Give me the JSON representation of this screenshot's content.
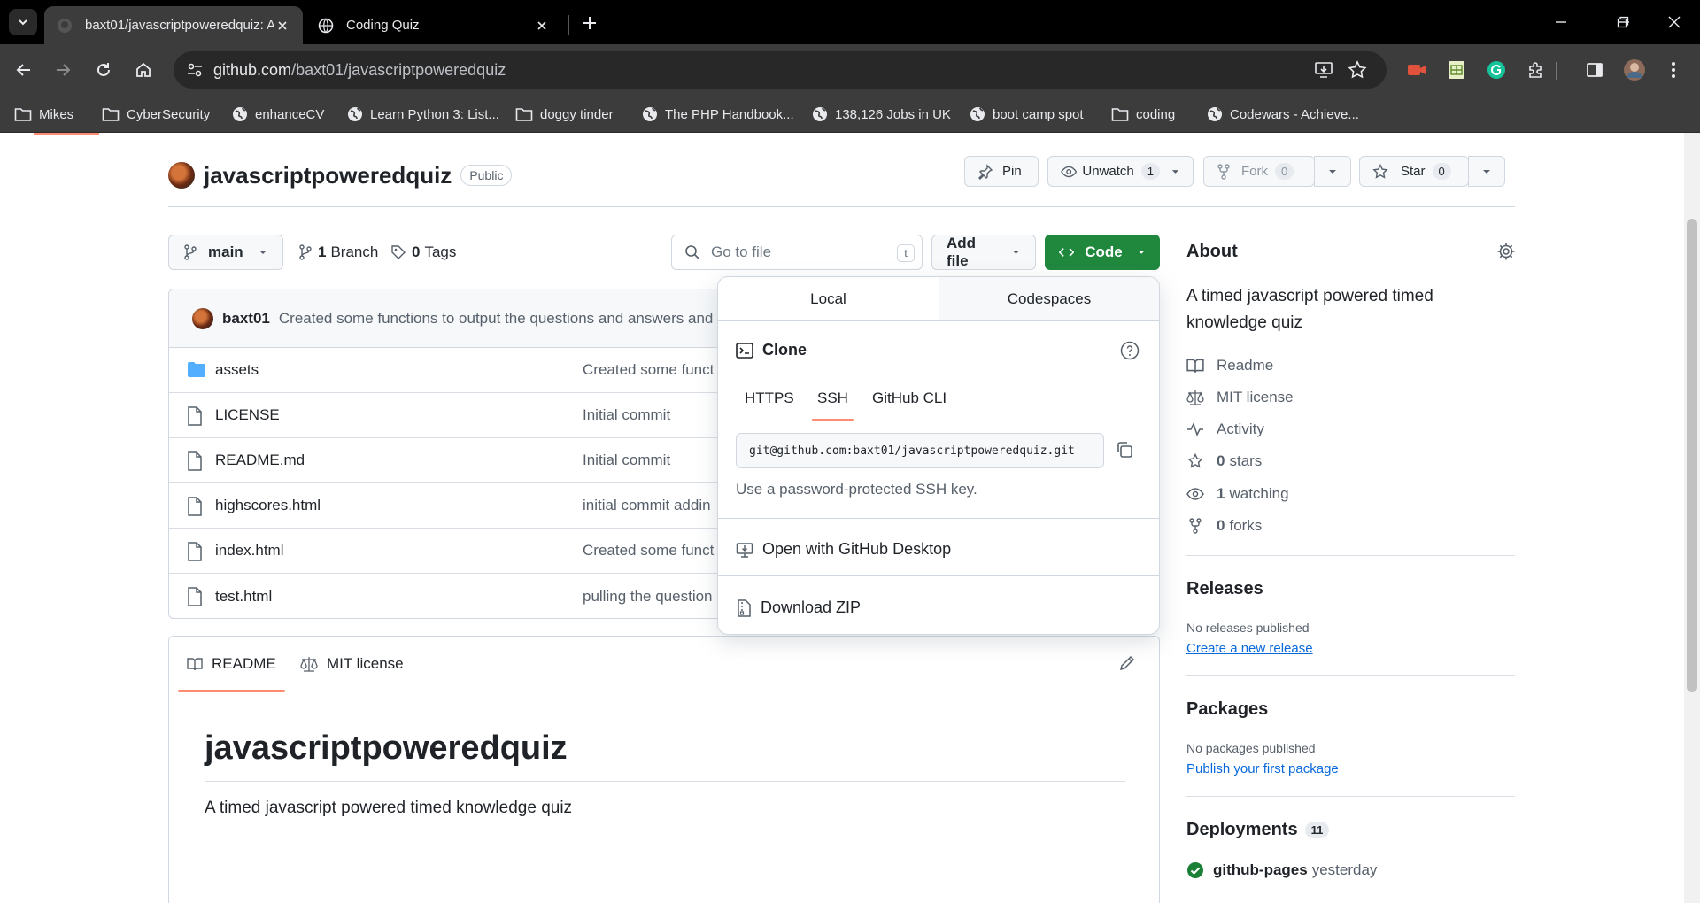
{
  "browser": {
    "tabs": [
      {
        "title": "baxt01/javascriptpoweredquiz: A",
        "active": true
      },
      {
        "title": "Coding Quiz",
        "active": false
      }
    ],
    "url_host": "github.com",
    "url_path": "/baxt01/javascriptpoweredquiz",
    "bookmarks": [
      {
        "label": "Mikes",
        "icon": "folder-icon"
      },
      {
        "label": "CyberSecurity",
        "icon": "folder-icon"
      },
      {
        "label": "enhanceCV",
        "icon": "globe-icon"
      },
      {
        "label": "Learn Python 3: List...",
        "icon": "globe-icon"
      },
      {
        "label": "doggy tinder",
        "icon": "folder-icon"
      },
      {
        "label": "The PHP Handbook...",
        "icon": "globe-icon"
      },
      {
        "label": "138,126 Jobs in UK",
        "icon": "globe-icon"
      },
      {
        "label": "boot camp spot",
        "icon": "globe-icon"
      },
      {
        "label": "coding",
        "icon": "folder-icon"
      },
      {
        "label": "Codewars - Achieve...",
        "icon": "globe-icon"
      }
    ]
  },
  "repo": {
    "name": "javascriptpoweredquiz",
    "visibility": "Public",
    "pin_label": "Pin",
    "unwatch_label": "Unwatch",
    "watch_count": "1",
    "fork_label": "Fork",
    "fork_count": "0",
    "star_label": "Star",
    "star_count": "0"
  },
  "code_bar": {
    "branch": "main",
    "branch_count": "1",
    "branch_label": "Branch",
    "tag_count": "0",
    "tag_label": "Tags",
    "goto_placeholder": "Go to file",
    "goto_key": "t",
    "add_file_label": "Add file",
    "code_label": "Code"
  },
  "commit": {
    "user": "baxt01",
    "message": "Created some functions to output the questions and answers and"
  },
  "files": [
    {
      "name": "assets",
      "type": "folder",
      "message": "Created some funct"
    },
    {
      "name": "LICENSE",
      "type": "file",
      "message": "Initial commit"
    },
    {
      "name": "README.md",
      "type": "file",
      "message": "Initial commit"
    },
    {
      "name": "highscores.html",
      "type": "file",
      "message": "initial commit addin"
    },
    {
      "name": "index.html",
      "type": "file",
      "message": "Created some funct"
    },
    {
      "name": "test.html",
      "type": "file",
      "message": "pulling the question"
    }
  ],
  "readme": {
    "tab_readme": "README",
    "tab_license": "MIT license",
    "heading": "javascriptpoweredquiz",
    "description": "A timed javascript powered timed knowledge quiz"
  },
  "about": {
    "title": "About",
    "description": "A timed javascript powered timed knowledge quiz",
    "links": {
      "readme": "Readme",
      "license": "MIT license",
      "activity": "Activity",
      "stars_count": "0",
      "stars_label": "stars",
      "watching_count": "1",
      "watching_label": "watching",
      "forks_count": "0",
      "forks_label": "forks"
    }
  },
  "releases": {
    "title": "Releases",
    "empty": "No releases published",
    "link": "Create a new release"
  },
  "packages": {
    "title": "Packages",
    "empty": "No packages published",
    "link": "Publish your first package"
  },
  "deployments": {
    "title": "Deployments",
    "count": "11",
    "item_name": "github-pages",
    "item_time": "yesterday"
  },
  "clone_popover": {
    "tab_local": "Local",
    "tab_codespaces": "Codespaces",
    "clone_label": "Clone",
    "protocols": [
      "HTTPS",
      "SSH",
      "GitHub CLI"
    ],
    "selected_protocol": "SSH",
    "ssh_url": "git@github.com:baxt01/javascriptpoweredquiz.git",
    "hint": "Use a password-protected SSH key.",
    "open_desktop": "Open with GitHub Desktop",
    "download_zip": "Download ZIP"
  },
  "colors": {
    "accent_green": "#1f883d",
    "accent_underline": "#fd8c73",
    "link_blue": "#0969da",
    "success_green": "#1a7f37"
  }
}
